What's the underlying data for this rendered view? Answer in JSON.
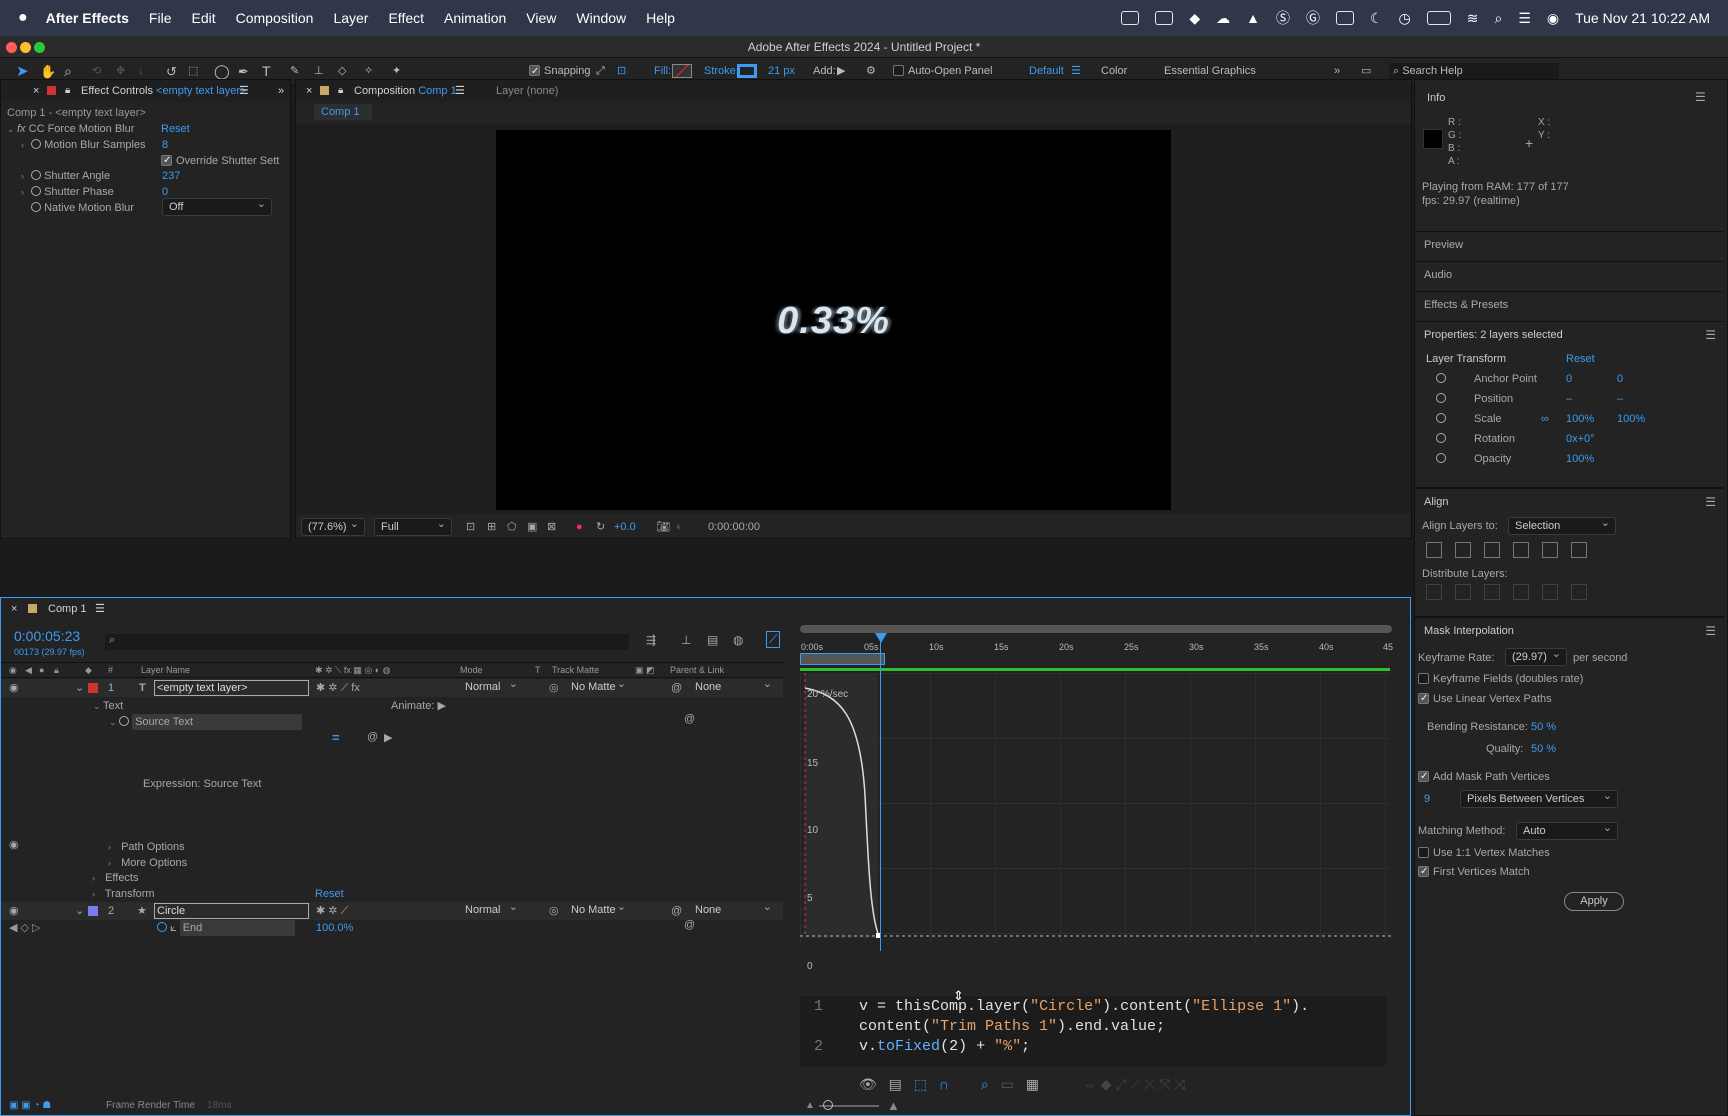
{
  "menubar": {
    "app": "After Effects",
    "items": [
      "File",
      "Edit",
      "Composition",
      "Layer",
      "Effect",
      "Animation",
      "View",
      "Window",
      "Help"
    ],
    "clock": "Tue Nov 21  10:22 AM"
  },
  "window": {
    "title": "Adobe After Effects 2024 - Untitled Project *"
  },
  "toolbar": {
    "snapping": "Snapping",
    "fill": "Fill:",
    "stroke": "Stroke:",
    "stroke_px": "21 px",
    "add": "Add:",
    "auto_open": "Auto-Open Panel",
    "ws_default": "Default",
    "ws_color": "Color",
    "ws_essential": "Essential Graphics",
    "search_help": "Search Help"
  },
  "effect_controls": {
    "tab": "Effect Controls",
    "tab_layer": "<empty text layer>",
    "path": "Comp 1 - <empty text layer>",
    "effect": "CC Force Motion Blur",
    "reset": "Reset",
    "rows": [
      {
        "label": "Motion Blur Samples",
        "value": "8"
      },
      {
        "label": "Override Shutter Sett",
        "value": ""
      },
      {
        "label": "Shutter Angle",
        "value": "237"
      },
      {
        "label": "Shutter Phase",
        "value": "0"
      },
      {
        "label": "Native Motion Blur",
        "value": "Off"
      }
    ]
  },
  "composition": {
    "tab": "Composition",
    "tab_comp": "Comp 1",
    "layer_tab": "Layer (none)",
    "breadcrumb": "Comp 1",
    "display_text": "0.33%",
    "zoom": "(77.6%)",
    "quality": "Full",
    "exposure": "+0.0",
    "timecode": "0:00:00:00"
  },
  "info": {
    "title": "Info",
    "r": "R :",
    "g": "G :",
    "b": "B :",
    "a": "A :",
    "x": "X :",
    "y": "Y :",
    "line1": "Playing from RAM: 177 of 177",
    "line2": "fps: 29.97 (realtime)"
  },
  "sections": {
    "preview": "Preview",
    "audio": "Audio",
    "effects_presets": "Effects & Presets"
  },
  "properties": {
    "title": "Properties: 2 layers selected",
    "layer_transform": "Layer Transform",
    "reset": "Reset",
    "rows": [
      {
        "label": "Anchor Point",
        "v1": "0",
        "v2": "0"
      },
      {
        "label": "Position",
        "v1": "–",
        "v2": "–"
      },
      {
        "label": "Scale",
        "v1": "100%",
        "v2": "100%"
      },
      {
        "label": "Rotation",
        "v1": "0x+0°",
        "v2": ""
      },
      {
        "label": "Opacity",
        "v1": "100%",
        "v2": ""
      }
    ]
  },
  "align": {
    "title": "Align",
    "align_to": "Align Layers to:",
    "selection": "Selection",
    "distribute": "Distribute Layers:"
  },
  "mask": {
    "title": "Mask Interpolation",
    "keyframe_rate": "Keyframe Rate:",
    "rate": "(29.97)",
    "per_second": "per second",
    "keyframe_fields": "Keyframe Fields (doubles rate)",
    "linear": "Use Linear Vertex Paths",
    "bending": "Bending Resistance:",
    "bending_val": "50 %",
    "quality": "Quality:",
    "quality_val": "50 %",
    "add_vertices": "Add Mask Path Vertices",
    "vertex_count": "9",
    "pixels_between": "Pixels Between Vertices",
    "matching": "Matching Method:",
    "matching_val": "Auto",
    "one_to_one": "Use 1:1 Vertex Matches",
    "first_vertices": "First Vertices Match",
    "apply": "Apply"
  },
  "timeline": {
    "tab": "Comp 1",
    "time": "0:00:05:23",
    "frames": "00173 (29.97 fps)",
    "headers": {
      "num": "#",
      "layer_name": "Layer Name",
      "mode": "Mode",
      "t": "T",
      "track_matte": "Track Matte",
      "parent": "Parent & Link"
    },
    "layer1": {
      "num": "1",
      "name": "<empty text layer>",
      "mode": "Normal",
      "matte": "No Matte",
      "parent": "None"
    },
    "text": "Text",
    "animate": "Animate:",
    "source_text": "Source Text",
    "expression": "Expression: Source Text",
    "path_options": "Path Options",
    "more_options": "More Options",
    "effects": "Effects",
    "transform": "Transform",
    "reset": "Reset",
    "layer2": {
      "num": "2",
      "name": "Circle",
      "mode": "Normal",
      "matte": "No Matte",
      "parent": "None"
    },
    "end": "End",
    "end_val": "100.0%",
    "ruler": [
      "0:00s",
      "05s",
      "10s",
      "15s",
      "20s",
      "25s",
      "30s",
      "35s",
      "40s",
      "45"
    ],
    "graph_label": "20 %/sec",
    "y_ticks": [
      "15",
      "10",
      "5",
      "0"
    ],
    "render_time": "Frame Render Time",
    "render_ms": "18ms"
  },
  "code": {
    "l1": "1",
    "l2": "2",
    "a1": "v = thisComp.layer(",
    "a2": "\"Circle\"",
    "a3": ").content(",
    "a4": "\"Ellipse 1\"",
    "a5": ").",
    "b1": "content(",
    "b2": "\"Trim Paths 1\"",
    "b3": ").end.value;",
    "c1": "v.",
    "c2": "toFixed",
    "c3": "(2) + ",
    "c4": "\"%\"",
    "c5": ";"
  }
}
